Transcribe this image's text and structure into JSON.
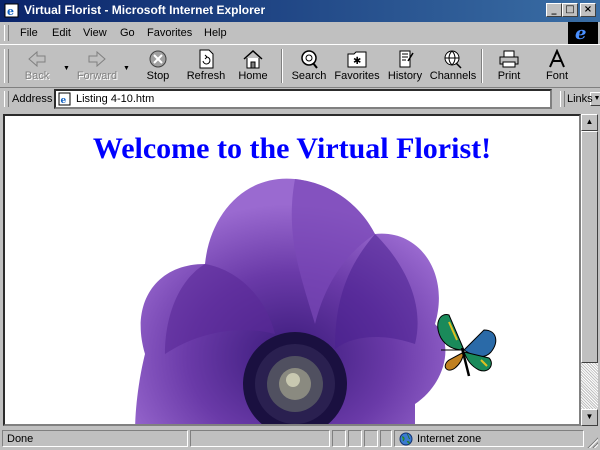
{
  "window": {
    "title": "Virtual Florist - Microsoft Internet Explorer"
  },
  "menu": [
    {
      "label": "File"
    },
    {
      "label": "Edit"
    },
    {
      "label": "View"
    },
    {
      "label": "Go"
    },
    {
      "label": "Favorites"
    },
    {
      "label": "Help"
    }
  ],
  "toolbar": {
    "back": "Back",
    "forward": "Forward",
    "stop": "Stop",
    "refresh": "Refresh",
    "home": "Home",
    "search": "Search",
    "favorites": "Favorites",
    "history": "History",
    "channels": "Channels",
    "print": "Print",
    "font": "Font"
  },
  "address": {
    "label": "Address",
    "value": "Listing 4-10.htm",
    "links": "Links"
  },
  "page": {
    "heading": "Welcome to the Virtual Florist!",
    "heading_color": "#0000ff"
  },
  "status": {
    "text": "Done",
    "zone": "Internet zone"
  },
  "icons": [
    "ie-logo-icon",
    "back-arrow-icon",
    "forward-arrow-icon",
    "stop-icon",
    "refresh-icon",
    "home-icon",
    "search-icon",
    "favorites-icon",
    "history-icon",
    "channels-icon",
    "print-icon",
    "font-icon",
    "page-icon",
    "globe-icon"
  ],
  "colors": {
    "titlebar": "#0a246a",
    "chrome": "#c0c0c0"
  }
}
